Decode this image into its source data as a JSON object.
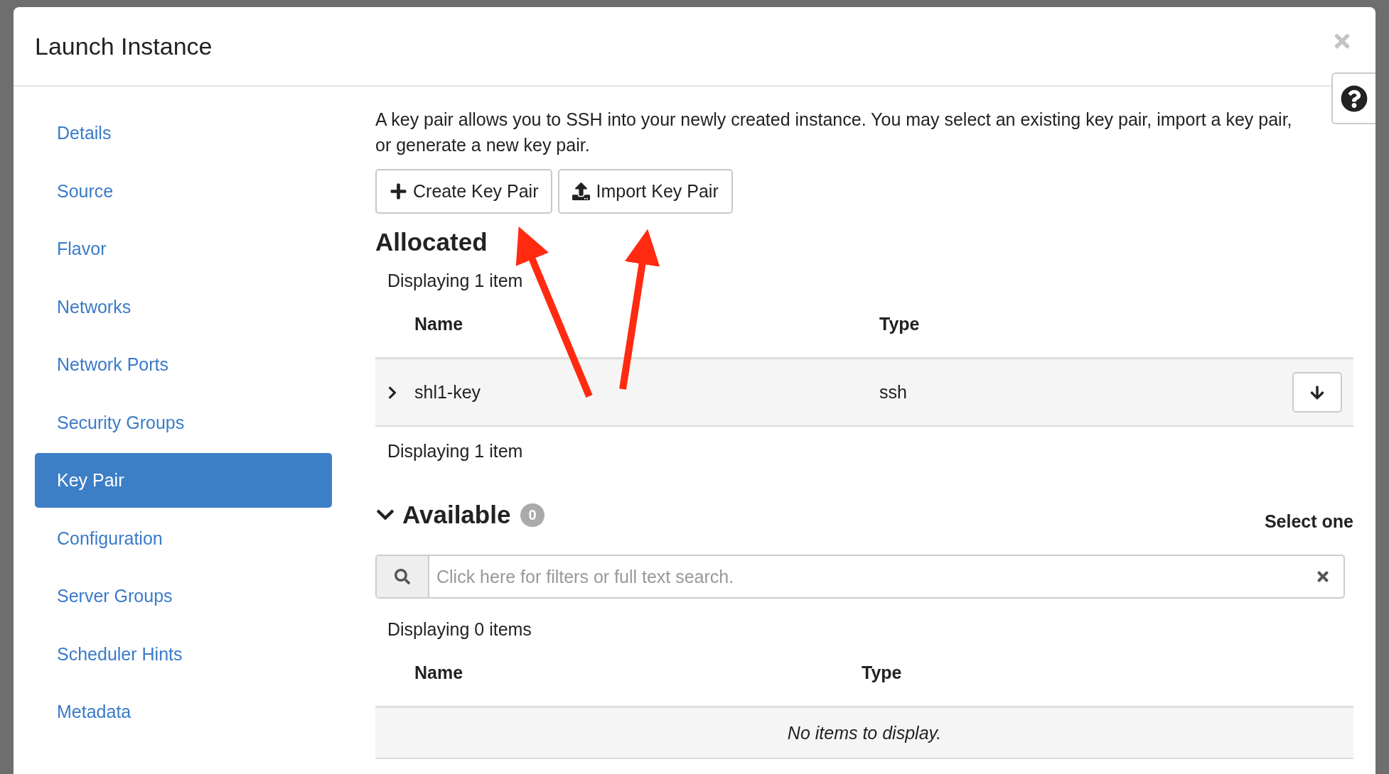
{
  "window": {
    "title": "Launch Instance"
  },
  "sidebar": {
    "items": [
      {
        "label": "Details",
        "selected": false
      },
      {
        "label": "Source",
        "selected": false
      },
      {
        "label": "Flavor",
        "selected": false
      },
      {
        "label": "Networks",
        "selected": false
      },
      {
        "label": "Network Ports",
        "selected": false
      },
      {
        "label": "Security Groups",
        "selected": false
      },
      {
        "label": "Key Pair",
        "selected": true
      },
      {
        "label": "Configuration",
        "selected": false
      },
      {
        "label": "Server Groups",
        "selected": false
      },
      {
        "label": "Scheduler Hints",
        "selected": false
      },
      {
        "label": "Metadata",
        "selected": false
      }
    ]
  },
  "intro": "A key pair allows you to SSH into your newly created instance. You may select an existing key pair, import a key pair, or generate a new key pair.",
  "actions": [
    {
      "label": "Create Key Pair",
      "kind": "create"
    },
    {
      "label": "Import Key Pair",
      "kind": "import"
    }
  ],
  "allocated": {
    "title": "Allocated",
    "count_top": "Displaying 1 item",
    "columns": [
      "Name",
      "Type"
    ],
    "rows": [
      {
        "name": "shl1-key",
        "type": "ssh",
        "expanded": false
      }
    ],
    "count_bottom": "Displaying 1 item"
  },
  "available": {
    "title": "Available",
    "badge": "0",
    "expanded": true,
    "select_hint": "Select one",
    "search": {
      "placeholder": "Click here for filters or full text search."
    },
    "count_top": "Displaying 0 items",
    "columns": [
      "Name",
      "Type"
    ],
    "empty_message": "No items to display."
  }
}
